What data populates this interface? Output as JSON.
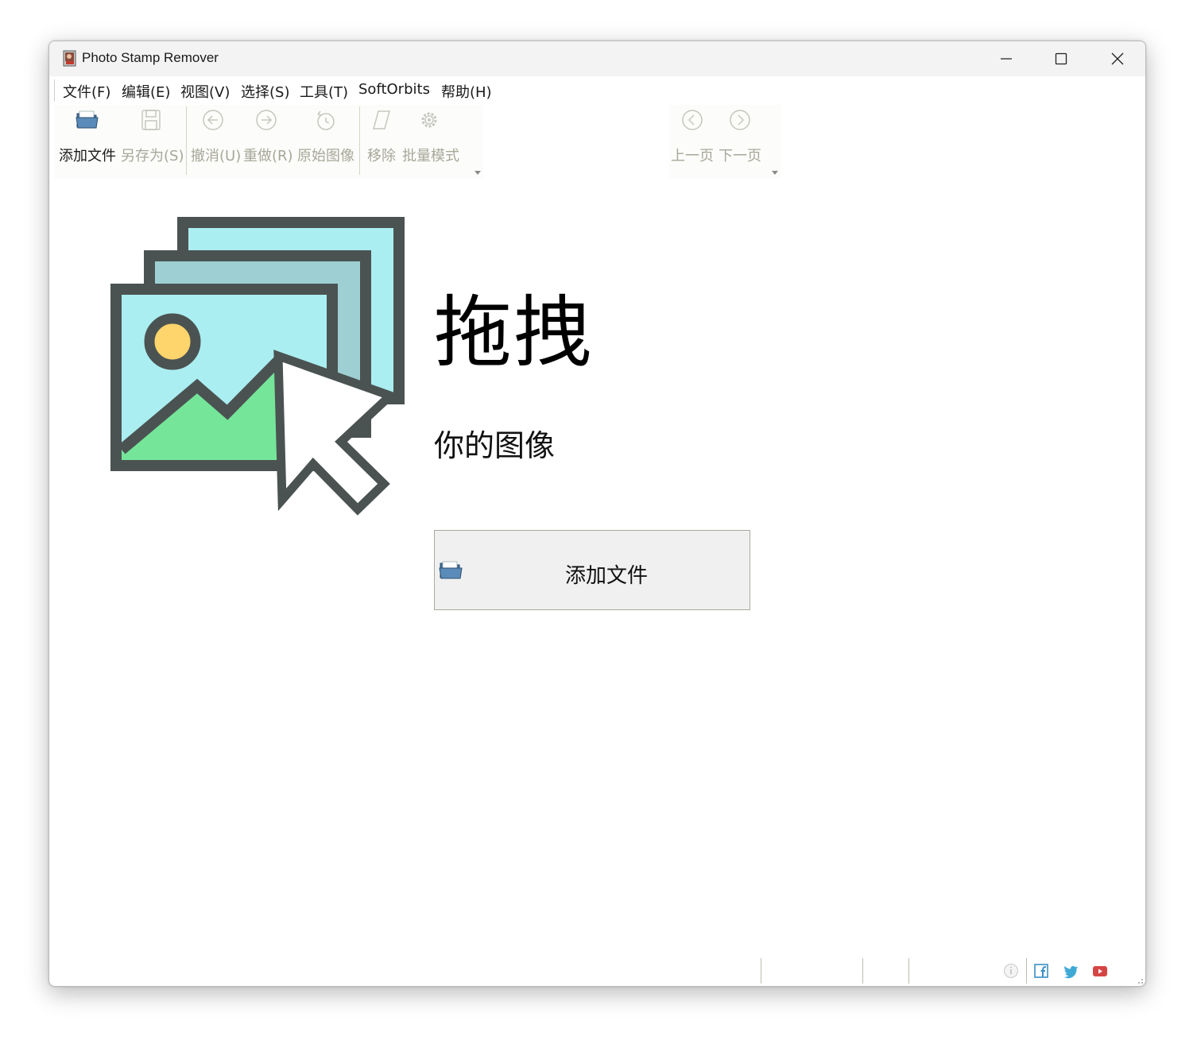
{
  "window": {
    "title": "Photo Stamp Remover"
  },
  "menu": [
    "文件(F)",
    "编辑(E)",
    "视图(V)",
    "选择(S)",
    "工具(T)",
    "SoftOrbits",
    "帮助(H)"
  ],
  "toolbar": {
    "add_file": "添加文件",
    "save_as": "另存为(S)",
    "undo": "撤消(U)",
    "redo": "重做(R)",
    "original": "原始图像",
    "remove": "移除",
    "batch": "批量模式",
    "prev": "上一页",
    "next": "下一页"
  },
  "main": {
    "drag_title": "拖拽",
    "drag_subtitle": "你的图像",
    "add_button": "添加文件"
  },
  "icons": {
    "app": "photo-stamp-remover-app-icon",
    "add_file": "open-folder-icon",
    "save_as": "floppy-disk-icon",
    "undo": "arrow-left-circle-icon",
    "redo": "arrow-right-circle-icon",
    "original": "restore-clock-icon",
    "remove": "eraser-icon",
    "batch": "gear-icon",
    "prev": "chevron-left-circle-icon",
    "next": "chevron-right-circle-icon",
    "info": "info-icon",
    "facebook": "facebook-icon",
    "twitter": "twitter-icon",
    "youtube": "youtube-icon"
  },
  "colors": {
    "disabled_text": "#a7a799",
    "folder_blue": "#4f7ba6",
    "image_cyan": "#abeef1",
    "image_teal": "#9ed0d3",
    "image_green": "#75e599",
    "image_sun": "#fed46c",
    "outline": "#4a5352"
  }
}
